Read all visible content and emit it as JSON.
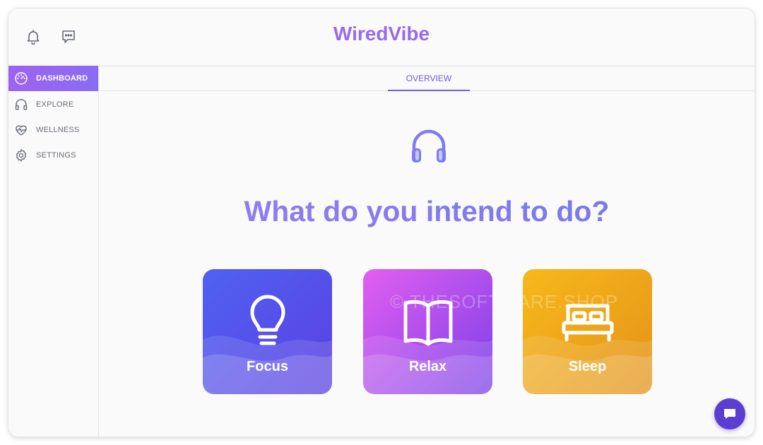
{
  "app": {
    "title": "WiredVibe"
  },
  "header": {
    "icons": [
      "bell-icon",
      "chat-icon"
    ]
  },
  "sidebar": {
    "items": [
      {
        "label": "DASHBOARD",
        "icon": "speedometer-icon",
        "active": true
      },
      {
        "label": "EXPLORE",
        "icon": "headphones-icon",
        "active": false
      },
      {
        "label": "WELLNESS",
        "icon": "heart-pulse-icon",
        "active": false
      },
      {
        "label": "SETTINGS",
        "icon": "gear-icon",
        "active": false
      }
    ]
  },
  "tabs": [
    {
      "label": "OVERVIEW",
      "active": true
    }
  ],
  "main": {
    "hero_icon": "headphones-icon",
    "question": "What do you intend to do?",
    "cards": [
      {
        "label": "Focus",
        "icon": "lightbulb-icon",
        "colors": [
          "#4f62f2",
          "#5b3fe0"
        ]
      },
      {
        "label": "Relax",
        "icon": "open-book-icon",
        "colors": [
          "#e35ff0",
          "#7b3fe8"
        ]
      },
      {
        "label": "Sleep",
        "icon": "bed-icon",
        "colors": [
          "#f7b91a",
          "#e3921a"
        ]
      }
    ]
  },
  "watermark": "© THESOFTWARE.SHOP",
  "colors": {
    "accent": "#7558e6",
    "brand_start": "#b068ee",
    "brand_end": "#7d6ef0",
    "chat_fab": "#5a3ed0"
  }
}
